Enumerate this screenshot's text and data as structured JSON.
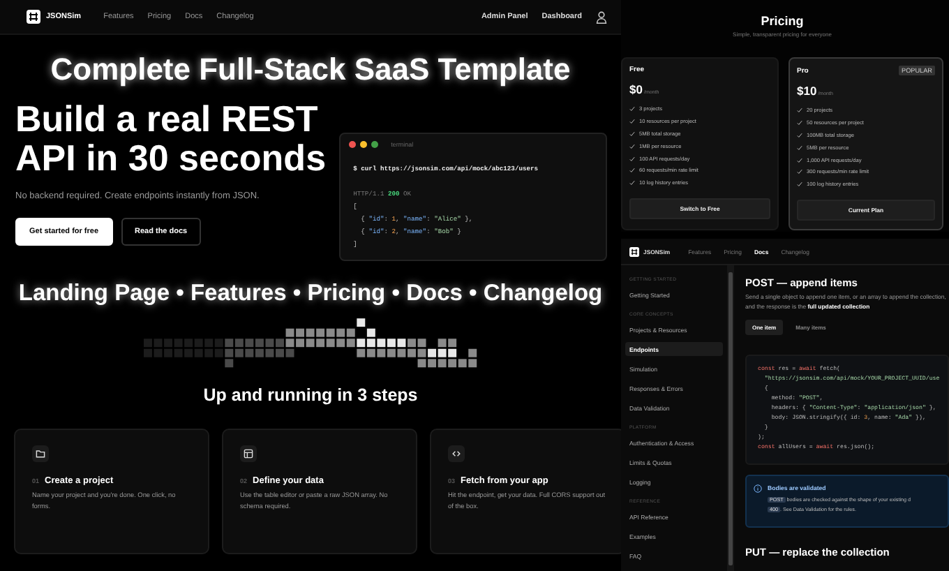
{
  "navbar": {
    "brand": "JSONSim",
    "links": [
      "Features",
      "Pricing",
      "Docs",
      "Changelog"
    ],
    "actions": [
      "Admin Panel",
      "Dashboard"
    ]
  },
  "headline": "Complete Full-Stack SaaS Template",
  "hero": {
    "title": "Build a real REST API in 30 seconds",
    "subtitle": "No backend required. Create endpoints instantly from JSON.",
    "buttons": [
      {
        "label": "Get started for free",
        "kind": "primary"
      },
      {
        "label": "Read the docs",
        "kind": "secondary"
      }
    ]
  },
  "terminal": {
    "title": "terminal",
    "lines": [
      [
        {
          "text": "$ curl https://jsonsim.com/api/mock/abc123/users",
          "kind": "command"
        }
      ],
      [
        {
          "text": "HTTP/1.1 ",
          "kind": "muted"
        },
        {
          "text": "200",
          "kind": "status"
        },
        {
          "text": " OK",
          "kind": "muted"
        }
      ],
      [
        {
          "text": "[",
          "kind": "plain"
        }
      ],
      [
        {
          "text": "  { ",
          "kind": "plain"
        },
        {
          "text": "\"id\"",
          "kind": "key"
        },
        {
          "text": ": ",
          "kind": "plain"
        },
        {
          "text": "1",
          "kind": "number"
        },
        {
          "text": ", ",
          "kind": "plain"
        },
        {
          "text": "\"name\"",
          "kind": "key"
        },
        {
          "text": ": ",
          "kind": "plain"
        },
        {
          "text": "\"Alice\"",
          "kind": "string"
        },
        {
          "text": " },",
          "kind": "plain"
        }
      ],
      [
        {
          "text": "  { ",
          "kind": "plain"
        },
        {
          "text": "\"id\"",
          "kind": "key"
        },
        {
          "text": ": ",
          "kind": "plain"
        },
        {
          "text": "2",
          "kind": "number"
        },
        {
          "text": ", ",
          "kind": "plain"
        },
        {
          "text": "\"name\"",
          "kind": "key"
        },
        {
          "text": ": ",
          "kind": "plain"
        },
        {
          "text": "\"Bob\"",
          "kind": "string"
        },
        {
          "text": " }",
          "kind": "plain"
        }
      ],
      [
        {
          "text": "]",
          "kind": "plain"
        }
      ]
    ]
  },
  "features_line": "Landing Page • Features • Pricing • Docs • Changelog",
  "steps": {
    "title": "Up and running in 3 steps",
    "items": [
      {
        "kind": "folder",
        "number": "01",
        "title": "Create a project",
        "text": "Name your project and you're done. One click, no forms."
      },
      {
        "kind": "table",
        "number": "02",
        "title": "Define your data",
        "text": "Use the table editor or paste a raw JSON array. No schema required."
      },
      {
        "kind": "code",
        "number": "03",
        "title": "Fetch from your app",
        "text": "Hit the endpoint, get your data. Full CORS support out of the box."
      }
    ]
  },
  "pricing": {
    "title": "Pricing",
    "subtitle": "Simple, transparent pricing for everyone",
    "plans": [
      {
        "name": "Free",
        "price": "$0",
        "period": "/month",
        "selected": false,
        "features": [
          "3 projects",
          "10 resources per project",
          "5MB total storage",
          "1MB per resource",
          "100 API requests/day",
          "60 requests/min rate limit",
          "10 log history entries"
        ],
        "button": "Switch to Free"
      },
      {
        "name": "Pro",
        "badge": "POPULAR",
        "price": "$10",
        "period": "/month",
        "selected": true,
        "features": [
          "20 projects",
          "50 resources per project",
          "100MB total storage",
          "5MB per resource",
          "1,000 API requests/day",
          "300 requests/min rate limit",
          "100 log history entries"
        ],
        "button": "Current Plan"
      }
    ]
  },
  "docs": {
    "navbar": {
      "brand": "JSONSim",
      "links": [
        {
          "label": "Features",
          "selected": false
        },
        {
          "label": "Pricing",
          "selected": false
        },
        {
          "label": "Docs",
          "selected": true
        },
        {
          "label": "Changelog",
          "selected": false
        }
      ]
    },
    "sidebar": [
      {
        "heading": "GETTING STARTED",
        "items": [
          {
            "label": "Getting Started",
            "selected": false
          }
        ]
      },
      {
        "heading": "CORE CONCEPTS",
        "items": [
          {
            "label": "Projects & Resources",
            "selected": false
          },
          {
            "label": "Endpoints",
            "selected": true
          },
          {
            "label": "Simulation",
            "selected": false
          },
          {
            "label": "Responses & Errors",
            "selected": false
          },
          {
            "label": "Data Validation",
            "selected": false
          }
        ]
      },
      {
        "heading": "PLATFORM",
        "items": [
          {
            "label": "Authentication & Access",
            "selected": false
          },
          {
            "label": "Limits & Quotas",
            "selected": false
          },
          {
            "label": "Logging",
            "selected": false
          }
        ]
      },
      {
        "heading": "REFERENCE",
        "items": [
          {
            "label": "API Reference",
            "selected": false
          },
          {
            "label": "Examples",
            "selected": false
          },
          {
            "label": "FAQ",
            "selected": false
          }
        ]
      }
    ],
    "section": {
      "title": "POST — append items",
      "text": "Send a single object to append one item, or an array to append the collection, and the response is the **full updated collection**",
      "tabs": [
        {
          "label": "One item",
          "selected": true
        },
        {
          "label": "Many items",
          "selected": false
        }
      ],
      "code": [
        [
          {
            "text": "const",
            "kind": "keyword"
          },
          {
            "text": " res = ",
            "kind": "plain"
          },
          {
            "text": "await",
            "kind": "keyword"
          },
          {
            "text": " fetch(",
            "kind": "plain"
          }
        ],
        [
          {
            "text": "  \"https://jsonsim.com/api/mock/YOUR_PROJECT_UUID/use",
            "kind": "string"
          }
        ],
        [
          {
            "text": "  {",
            "kind": "plain"
          }
        ],
        [
          {
            "text": "    method: ",
            "kind": "plain"
          },
          {
            "text": "\"POST\"",
            "kind": "string"
          },
          {
            "text": ",",
            "kind": "plain"
          }
        ],
        [
          {
            "text": "    headers: { ",
            "kind": "plain"
          },
          {
            "text": "\"Content-Type\"",
            "kind": "string"
          },
          {
            "text": ": ",
            "kind": "plain"
          },
          {
            "text": "\"application/json\"",
            "kind": "string"
          },
          {
            "text": " },",
            "kind": "plain"
          }
        ],
        [
          {
            "text": "    body: JSON.stringify({ id: ",
            "kind": "plain"
          },
          {
            "text": "3",
            "kind": "number"
          },
          {
            "text": ", name: ",
            "kind": "plain"
          },
          {
            "text": "\"Ada\"",
            "kind": "string"
          },
          {
            "text": " }),",
            "kind": "plain"
          }
        ],
        [
          {
            "text": "  }",
            "kind": "plain"
          }
        ],
        [
          {
            "text": ");",
            "kind": "plain"
          }
        ],
        [
          {
            "text": "const",
            "kind": "keyword"
          },
          {
            "text": " allUsers = ",
            "kind": "plain"
          },
          {
            "text": "await",
            "kind": "keyword"
          },
          {
            "text": " res.json();",
            "kind": "plain"
          }
        ]
      ],
      "callout": {
        "title": "Bodies are validated",
        "lines": [
          [
            {
              "text": "POST",
              "kind": "chip"
            },
            {
              "text": " bodies are checked against the shape of your existing d",
              "kind": "plain"
            }
          ],
          [
            {
              "text": "400",
              "kind": "chip"
            },
            {
              "text": ". See Data Validation for the rules.",
              "kind": "plain"
            }
          ]
        ]
      }
    },
    "next_title": "PUT — replace the collection"
  }
}
